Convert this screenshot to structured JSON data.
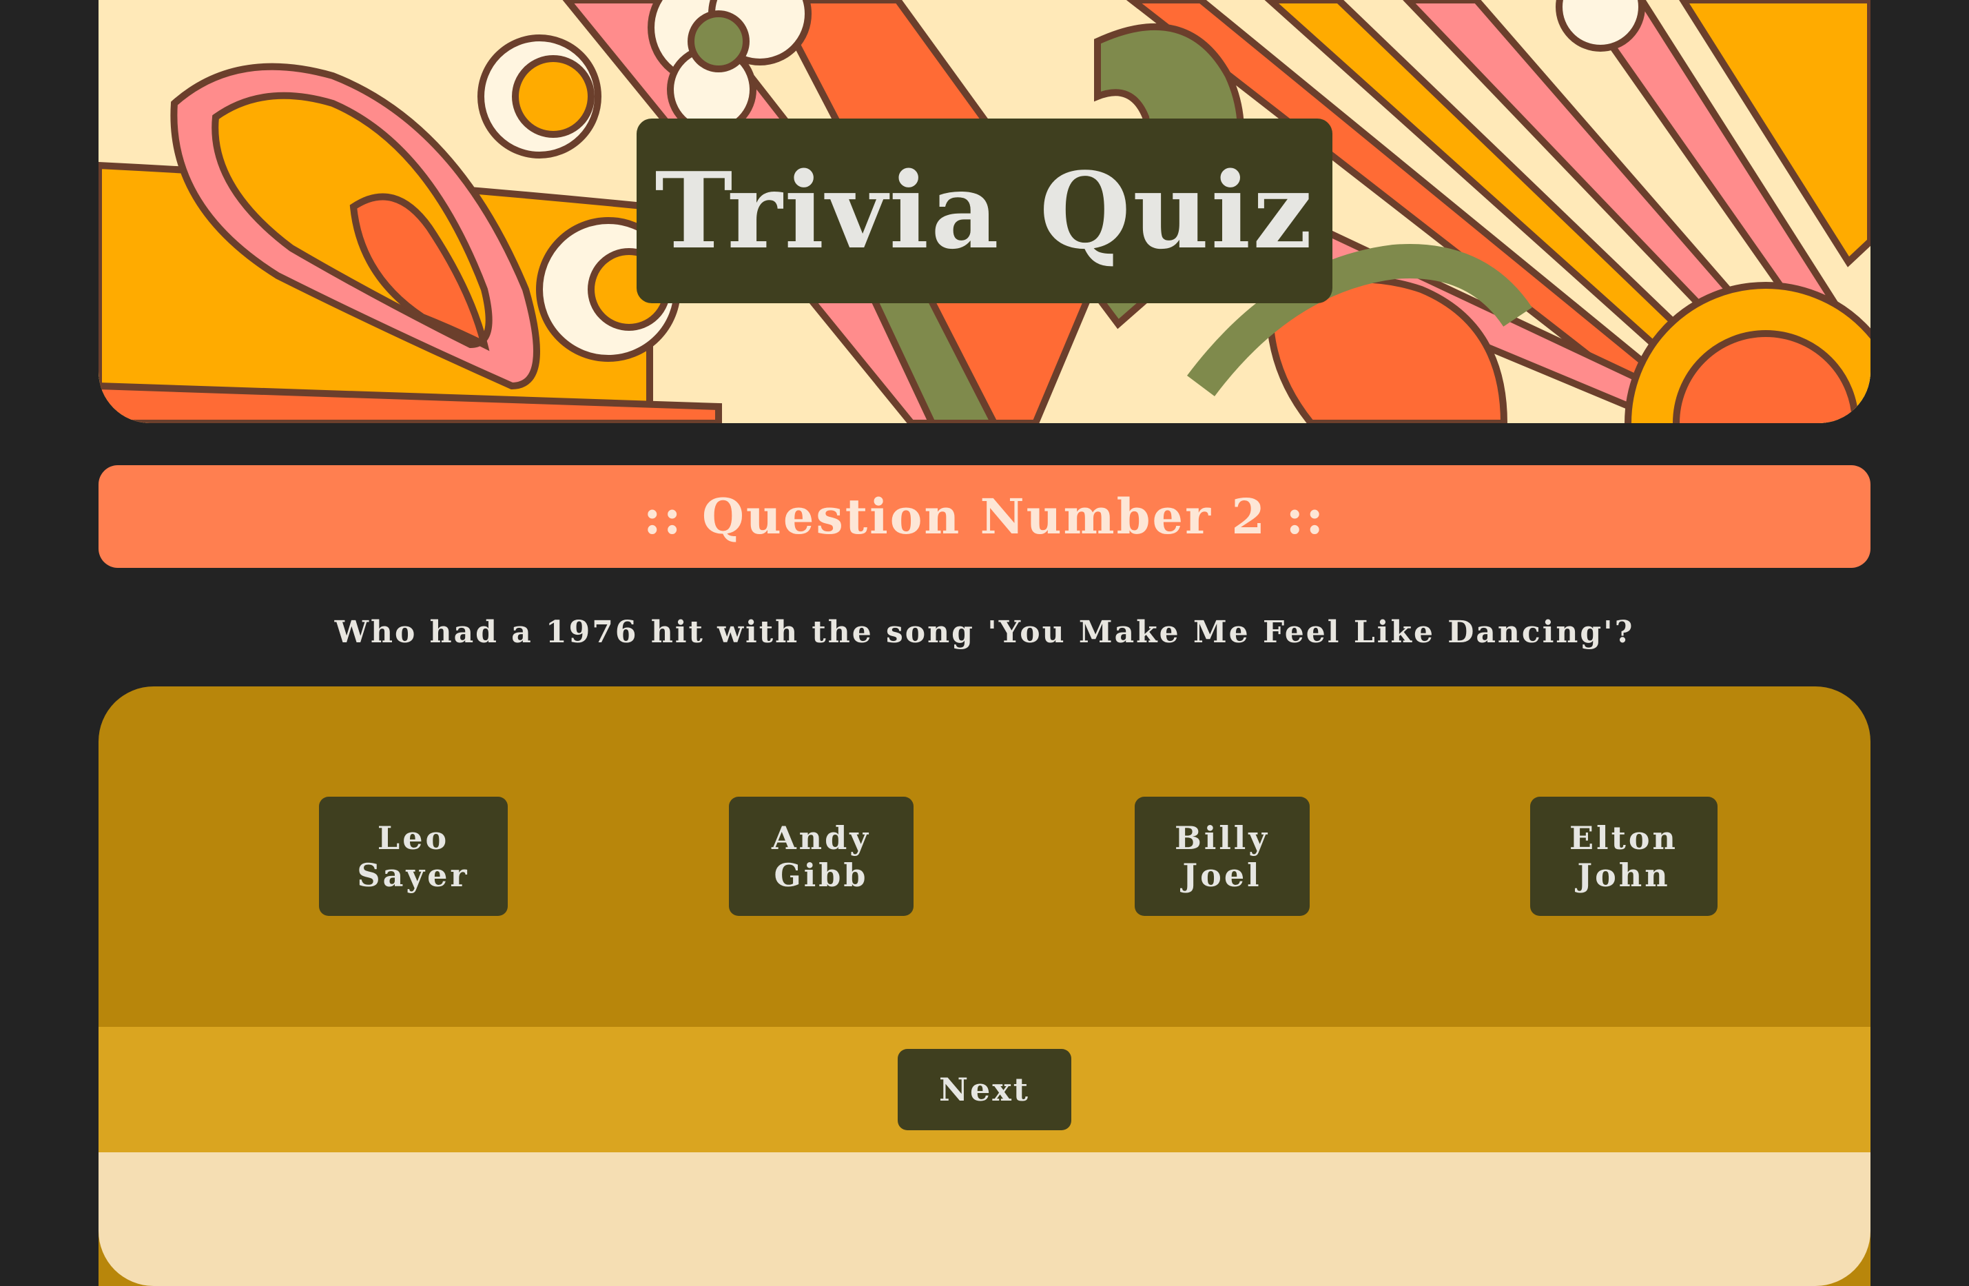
{
  "header": {
    "title": "Trivia Quiz"
  },
  "question_bar": {
    "label": ":: Question Number 2 ::"
  },
  "question": {
    "text": "Who had a 1976 hit with the song 'You Make Me Feel Like Dancing'?"
  },
  "answers": [
    {
      "line1": "Leo",
      "line2": "Sayer"
    },
    {
      "line1": "Andy",
      "line2": "Gibb"
    },
    {
      "line1": "Billy",
      "line2": "Joel"
    },
    {
      "line1": "Elton",
      "line2": "John"
    }
  ],
  "controls": {
    "next_label": "Next"
  },
  "colors": {
    "background": "#232323",
    "title_box": "#3f3f1f",
    "question_bar": "#ff7f50",
    "panel_top": "#b8860b",
    "panel_mid": "#daa520",
    "panel_bottom": "#f5deb3"
  }
}
